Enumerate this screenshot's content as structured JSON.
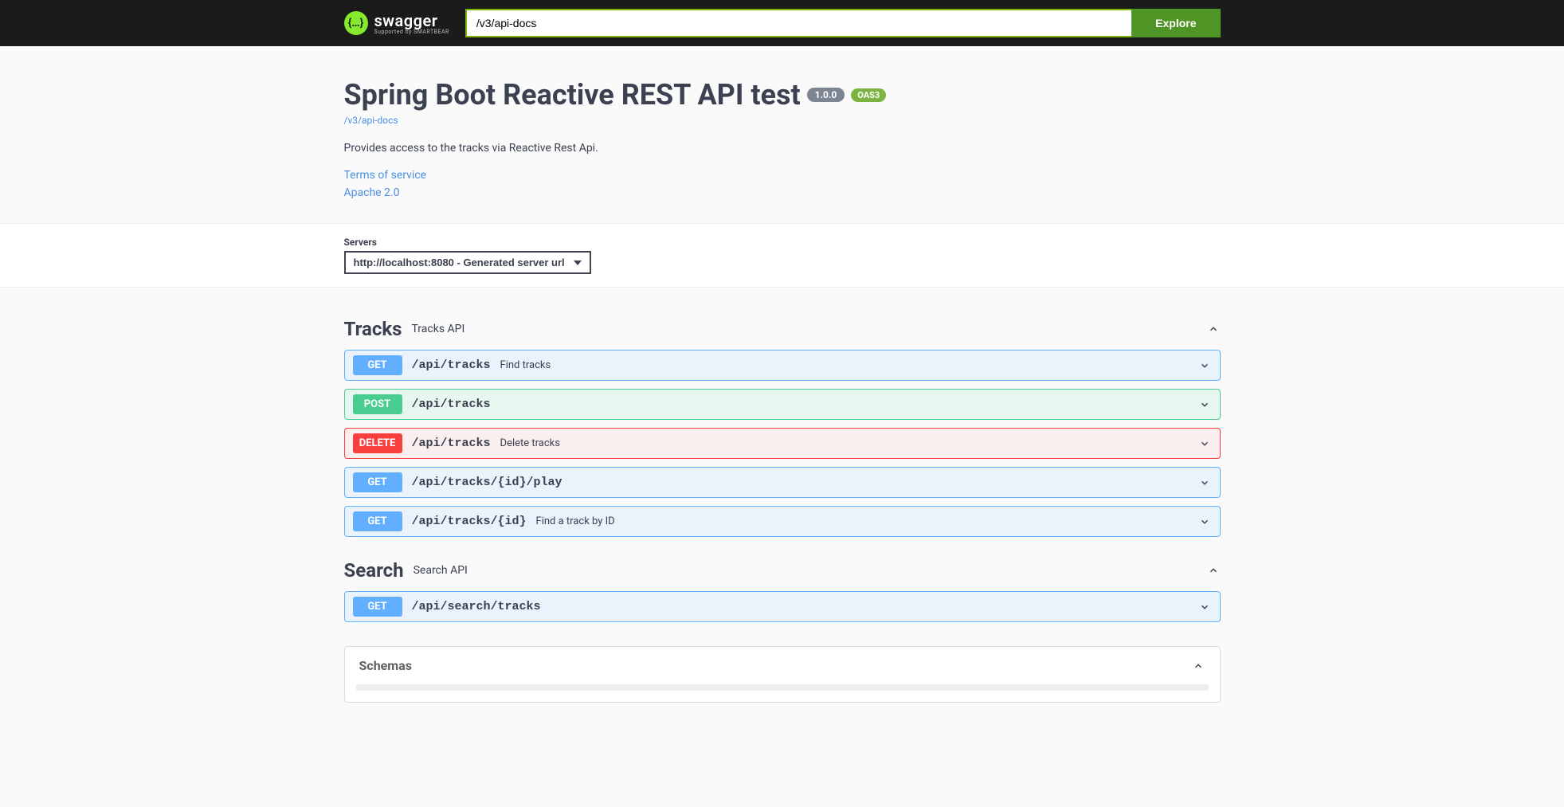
{
  "topbar": {
    "logo_text": "swagger",
    "logo_sub": "Supported by SMARTBEAR",
    "input_value": "/v3/api-docs",
    "explore_label": "Explore"
  },
  "info": {
    "title": "Spring Boot Reactive REST API test",
    "version": "1.0.0",
    "oas": "OAS3",
    "spec_link": "/v3/api-docs",
    "description": "Provides access to the tracks via Reactive Rest Api.",
    "tos": "Terms of service",
    "license": "Apache 2.0"
  },
  "servers": {
    "label": "Servers",
    "selected": "http://localhost:8080 - Generated server url"
  },
  "tags": [
    {
      "name": "Tracks",
      "desc": "Tracks API",
      "ops": [
        {
          "method": "GET",
          "path": "/api/tracks",
          "summary": "Find tracks"
        },
        {
          "method": "POST",
          "path": "/api/tracks",
          "summary": ""
        },
        {
          "method": "DELETE",
          "path": "/api/tracks",
          "summary": "Delete tracks"
        },
        {
          "method": "GET",
          "path": "/api/tracks/{id}/play",
          "summary": ""
        },
        {
          "method": "GET",
          "path": "/api/tracks/{id}",
          "summary": "Find a track by ID"
        }
      ]
    },
    {
      "name": "Search",
      "desc": "Search API",
      "ops": [
        {
          "method": "GET",
          "path": "/api/search/tracks",
          "summary": ""
        }
      ]
    }
  ],
  "schemas": {
    "title": "Schemas"
  }
}
